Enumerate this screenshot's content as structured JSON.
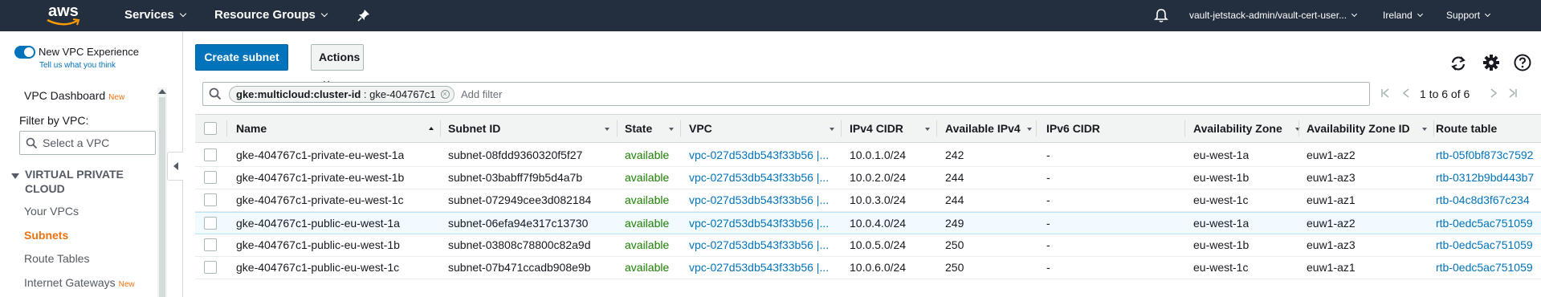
{
  "topnav": {
    "logo": "aws",
    "services": "Services",
    "resource_groups": "Resource Groups",
    "account": "vault-jetstack-admin/vault-cert-user...",
    "region": "Ireland",
    "support": "Support"
  },
  "sidebar": {
    "new_vpc_label": "New VPC Experience",
    "feedback_link": "Tell us what you think",
    "dashboard": "VPC Dashboard",
    "new_badge": "New",
    "filter_label": "Filter by VPC:",
    "select_placeholder": "Select a VPC",
    "section_title_1": "VIRTUAL PRIVATE",
    "section_title_2": "CLOUD",
    "items": [
      "Your VPCs",
      "Subnets",
      "Route Tables",
      "Internet Gateways"
    ],
    "internet_gateways_badge": "New"
  },
  "toolbar": {
    "create_label": "Create subnet",
    "actions_label": "Actions"
  },
  "filter": {
    "token_key": "gke:multicloud:cluster-id",
    "token_value": " : gke-404767c1",
    "add_filter": "Add filter",
    "pagination": "1 to 6 of 6"
  },
  "table": {
    "columns": [
      "Name",
      "Subnet ID",
      "State",
      "VPC",
      "IPv4 CIDR",
      "Available IPv4",
      "IPv6 CIDR",
      "Availability Zone",
      "Availability Zone ID",
      "Route table"
    ],
    "rows": [
      [
        "gke-404767c1-private-eu-west-1a",
        "subnet-08fdd9360320f5f27",
        "available",
        "vpc-027d53db543f33b56 |...",
        "10.0.1.0/24",
        "242",
        "-",
        "eu-west-1a",
        "euw1-az2",
        "rtb-05f0bf873c7592"
      ],
      [
        "gke-404767c1-private-eu-west-1b",
        "subnet-03babff7f9b5d4a7b",
        "available",
        "vpc-027d53db543f33b56 |...",
        "10.0.2.0/24",
        "244",
        "-",
        "eu-west-1b",
        "euw1-az3",
        "rtb-0312b9bd443b7"
      ],
      [
        "gke-404767c1-private-eu-west-1c",
        "subnet-072949cee3d082184",
        "available",
        "vpc-027d53db543f33b56 |...",
        "10.0.3.0/24",
        "244",
        "-",
        "eu-west-1c",
        "euw1-az1",
        "rtb-04c8d3f67c234"
      ],
      [
        "gke-404767c1-public-eu-west-1a",
        "subnet-06efa94e317c13730",
        "available",
        "vpc-027d53db543f33b56 |...",
        "10.0.4.0/24",
        "249",
        "-",
        "eu-west-1a",
        "euw1-az2",
        "rtb-0edc5ac751059"
      ],
      [
        "gke-404767c1-public-eu-west-1b",
        "subnet-03808c78800c82a9d",
        "available",
        "vpc-027d53db543f33b56 |...",
        "10.0.5.0/24",
        "250",
        "-",
        "eu-west-1b",
        "euw1-az3",
        "rtb-0edc5ac751059"
      ],
      [
        "gke-404767c1-public-eu-west-1c",
        "subnet-07b471ccadb908e9b",
        "available",
        "vpc-027d53db543f33b56 |...",
        "10.0.6.0/24",
        "250",
        "-",
        "eu-west-1c",
        "euw1-az1",
        "rtb-0edc5ac751059"
      ]
    ]
  },
  "colors": {
    "nav_bg": "#232f3e",
    "primary": "#0073bb",
    "available": "#1d8102",
    "accent": "#ec7211",
    "highlight_row": "#f1faff"
  },
  "icons": [
    "bell-icon",
    "pin-icon",
    "refresh-icon",
    "gear-icon",
    "help-icon",
    "search-icon"
  ]
}
